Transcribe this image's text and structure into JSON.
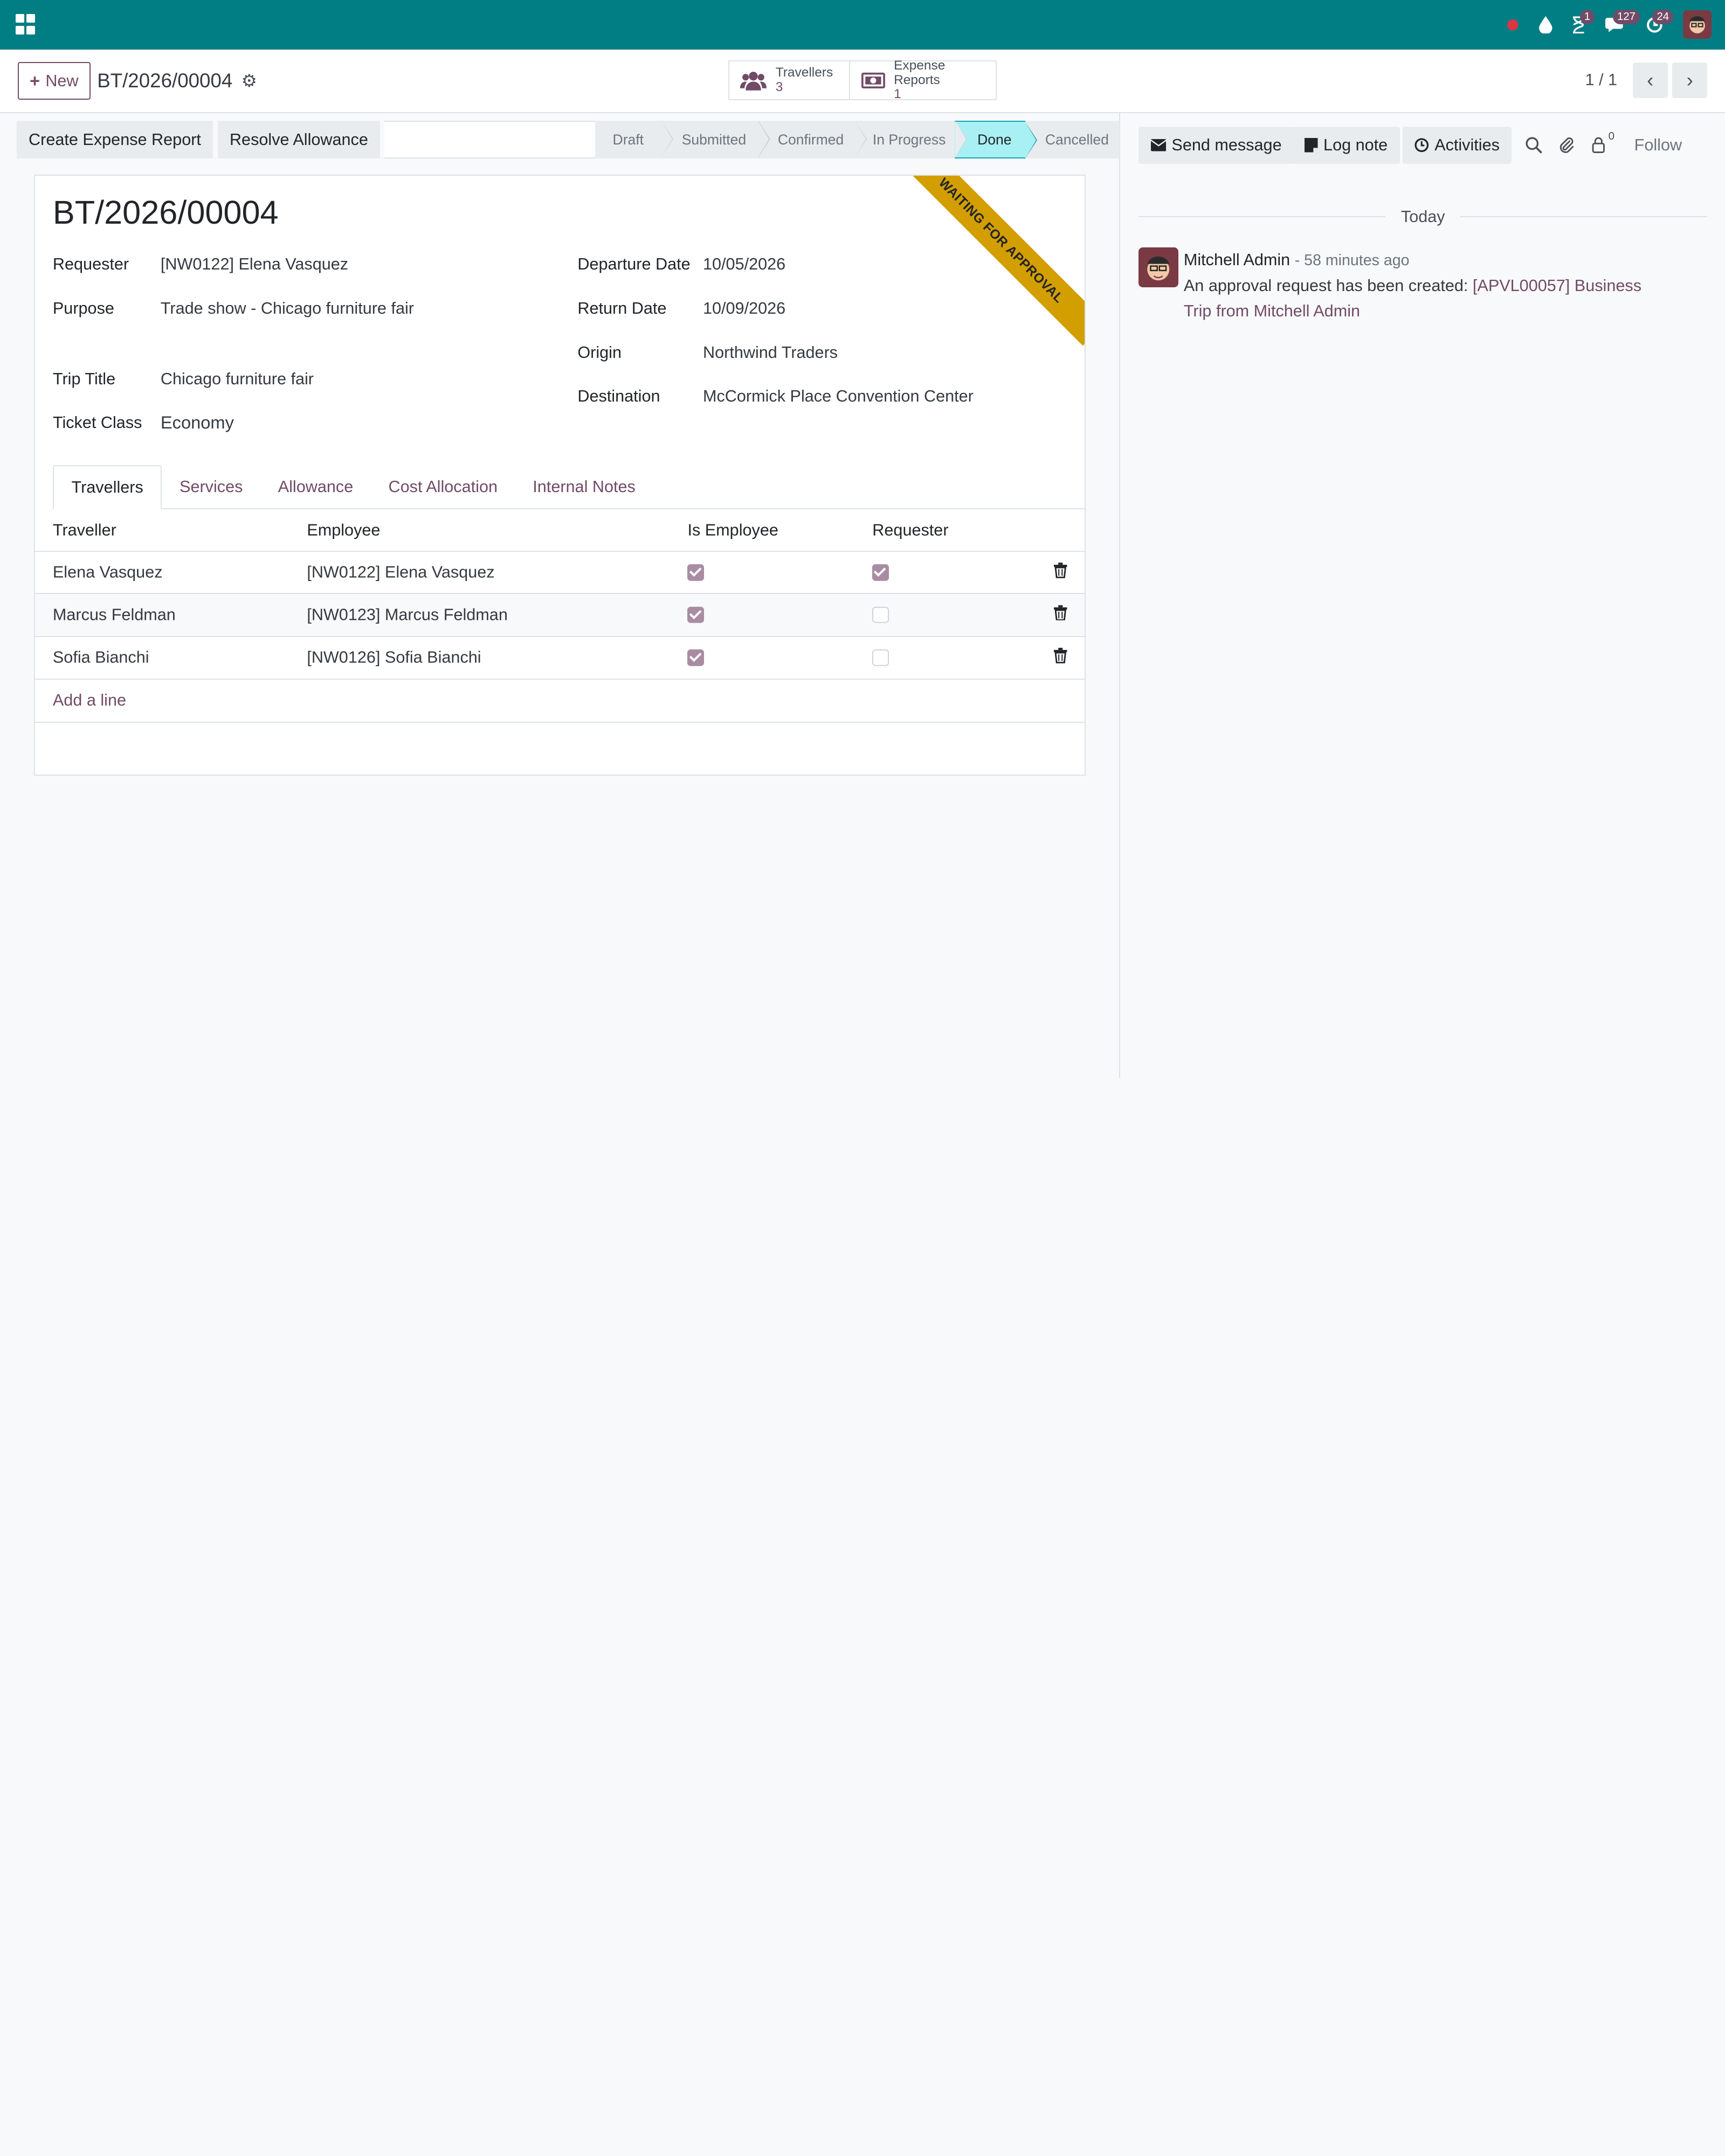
{
  "topnav": {
    "badges": {
      "activities": "1",
      "messages": "127",
      "updates": "24"
    }
  },
  "control": {
    "new_label": "New",
    "record_title": "BT/2026/00004",
    "smart_buttons": [
      {
        "label": "Travellers",
        "count": "3"
      },
      {
        "label": "Expense Reports",
        "count": "1"
      }
    ],
    "pager": "1 / 1"
  },
  "statusbar": {
    "buttons": [
      "Create Expense Report",
      "Resolve Allowance"
    ],
    "stages": [
      "Draft",
      "Submitted",
      "Confirmed",
      "In Progress",
      "Done",
      "Cancelled"
    ],
    "active_stage": "Done"
  },
  "form": {
    "title": "BT/2026/00004",
    "ribbon": "WAITING FOR APPROVAL",
    "fields": {
      "requester": {
        "label": "Requester",
        "value": "[NW0122] Elena Vasquez"
      },
      "purpose": {
        "label": "Purpose",
        "value": "Trade show - Chicago furniture fair"
      },
      "trip_title": {
        "label": "Trip Title",
        "value": "Chicago furniture fair"
      },
      "ticket_class": {
        "label": "Ticket Class",
        "value": "Economy"
      },
      "departure_date": {
        "label": "Departure Date",
        "value": "10/05/2026"
      },
      "return_date": {
        "label": "Return Date",
        "value": "10/09/2026"
      },
      "origin": {
        "label": "Origin",
        "value": "Northwind Traders"
      },
      "destination": {
        "label": "Destination",
        "value": "McCormick Place Convention Center"
      }
    },
    "tabs": [
      "Travellers",
      "Services",
      "Allowance",
      "Cost Allocation",
      "Internal Notes"
    ],
    "active_tab": "Travellers",
    "table": {
      "columns": [
        "Traveller",
        "Employee",
        "Is Employee",
        "Requester"
      ],
      "rows": [
        {
          "traveller": "Elena Vasquez",
          "employee": "[NW0122] Elena Vasquez",
          "is_employee": true,
          "requester": true
        },
        {
          "traveller": "Marcus Feldman",
          "employee": "[NW0123] Marcus Feldman",
          "is_employee": true,
          "requester": false
        },
        {
          "traveller": "Sofia Bianchi",
          "employee": "[NW0126] Sofia Bianchi",
          "is_employee": true,
          "requester": false
        }
      ],
      "add_line": "Add a line"
    }
  },
  "chatter": {
    "send_message": "Send message",
    "log_note": "Log note",
    "activities": "Activities",
    "follower_count": "0",
    "follow": "Follow",
    "date_separator": "Today",
    "message": {
      "author": "Mitchell Admin",
      "time": "- 58 minutes ago",
      "text": "An approval request has been created: ",
      "link": "[APVL00057] Business Trip from Mitchell Admin"
    }
  },
  "colors": {
    "brand": "#017e84",
    "accent": "#714b67",
    "ribbon": "#d39e00",
    "active_stage": "#a8f0f4"
  }
}
